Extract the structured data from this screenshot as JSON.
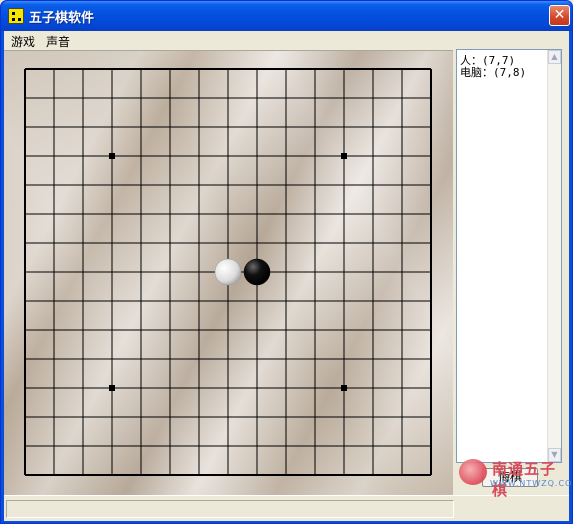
{
  "window": {
    "title": "五子棋软件",
    "close_glyph": "✕"
  },
  "menu": {
    "game": "游戏",
    "sound": "声音"
  },
  "board": {
    "size": 15,
    "star_points": [
      [
        3,
        3
      ],
      [
        11,
        3
      ],
      [
        3,
        11
      ],
      [
        11,
        11
      ]
    ],
    "stones": [
      {
        "col": 7,
        "row": 7,
        "color": "white"
      },
      {
        "col": 8,
        "row": 7,
        "color": "black"
      }
    ]
  },
  "moves_log": {
    "line1": "人：(7,7)",
    "line2": "电脑：(7,8)"
  },
  "buttons": {
    "undo": "悔棋"
  },
  "watermark": {
    "name": "南通五子棋",
    "url": "WWW.NTWZQ.COM"
  }
}
